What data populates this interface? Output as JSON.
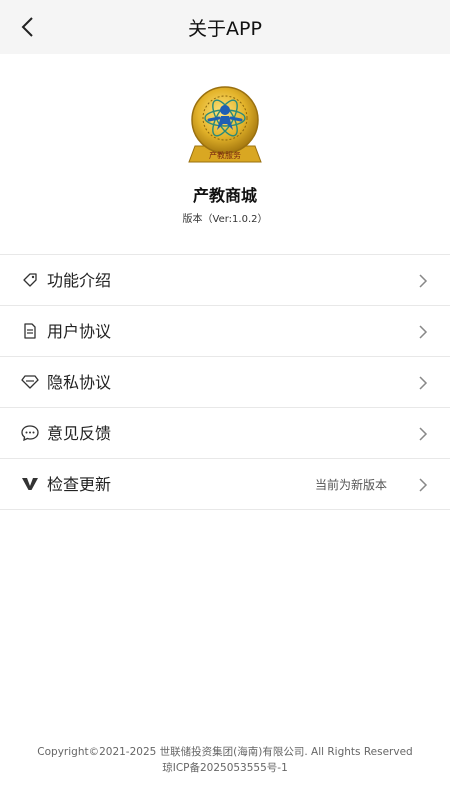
{
  "header": {
    "title": "关于APP"
  },
  "app": {
    "name": "产教商城",
    "version": "版本（Ver:1.0.2）",
    "logo_text": "产教服务"
  },
  "menu": {
    "items": [
      {
        "label": "功能介绍",
        "icon": "tag-icon"
      },
      {
        "label": "用户协议",
        "icon": "document-icon"
      },
      {
        "label": "隐私协议",
        "icon": "diamond-icon"
      },
      {
        "label": "意见反馈",
        "icon": "chat-bubble-icon"
      },
      {
        "label": "检查更新",
        "icon": "v-icon",
        "extra": "当前为新版本"
      }
    ]
  },
  "footer": {
    "copyright": "Copyright©2021-2025 世联储投资集团(海南)有限公司. All Rights Reserved",
    "icp": "琼ICP备2025053555号-1"
  }
}
